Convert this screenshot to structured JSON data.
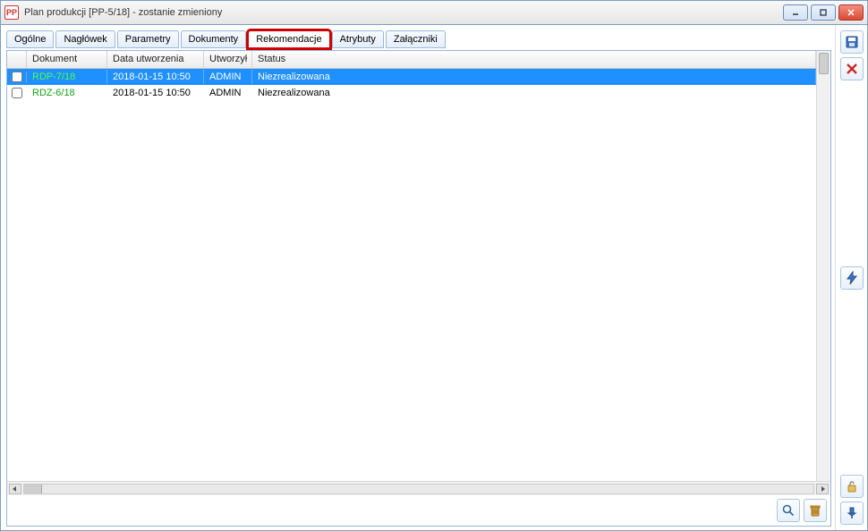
{
  "window": {
    "app_icon_text": "PP",
    "title": "Plan produkcji [PP-5/18] - zostanie zmieniony"
  },
  "tabs": [
    {
      "label": "Ogólne"
    },
    {
      "label": "Nagłówek"
    },
    {
      "label": "Parametry"
    },
    {
      "label": "Dokumenty"
    },
    {
      "label": "Rekomendacje"
    },
    {
      "label": "Atrybuty"
    },
    {
      "label": "Załączniki"
    }
  ],
  "active_tab_index": 4,
  "highlighted_tab_index": 4,
  "grid": {
    "columns": {
      "dokument": "Dokument",
      "data": "Data utworzenia",
      "utworzyl": "Utworzył",
      "status": "Status"
    },
    "rows": [
      {
        "checked": false,
        "dokument": "RDP-7/18",
        "data": "2018-01-15 10:50",
        "utworzyl": "ADMIN",
        "status": "Niezrealizowana",
        "selected": true
      },
      {
        "checked": false,
        "dokument": "RDZ-6/18",
        "data": "2018-01-15 10:50",
        "utworzyl": "ADMIN",
        "status": "Niezrealizowana",
        "selected": false
      }
    ]
  },
  "icons": {
    "save": "save-icon",
    "close": "close-icon",
    "lightning": "lightning-icon",
    "lock": "lock-icon",
    "pin": "pin-icon",
    "search": "search-icon",
    "delete": "delete-icon"
  }
}
